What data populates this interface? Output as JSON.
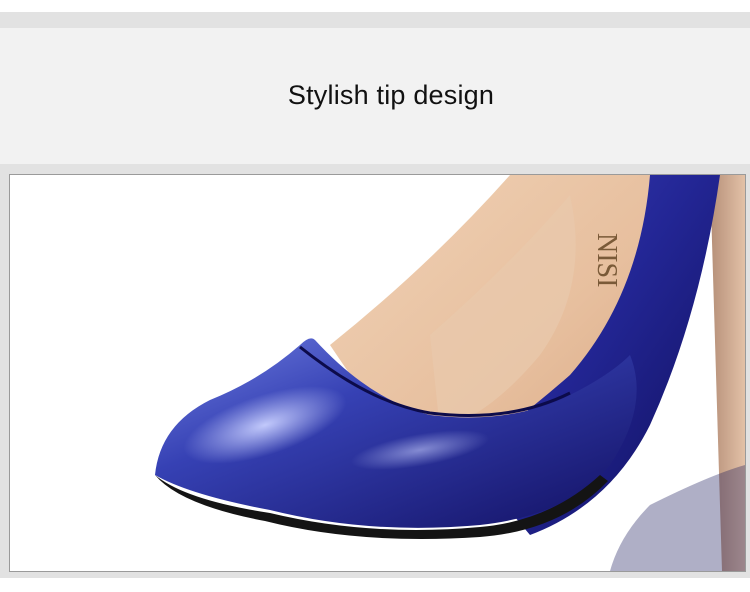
{
  "caption": "Stylish tip design",
  "product_image": {
    "brand_mark_text": "NISI",
    "colors": {
      "patent_blue_dark": "#14126a",
      "patent_blue_mid": "#2b2fa0",
      "patent_blue_light": "#6a78d8",
      "lining": "#e8c3a3",
      "heel_tone": "#c9a48a",
      "background": "#ffffff"
    }
  }
}
